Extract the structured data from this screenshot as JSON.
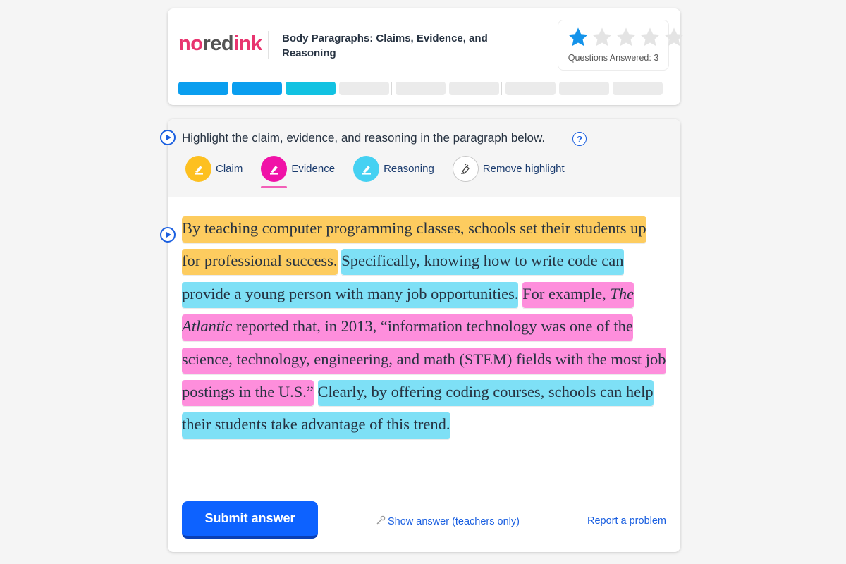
{
  "brand": {
    "logo_no": "no",
    "logo_red": "red",
    "logo_ink": "ink",
    "pink": "#e8346f"
  },
  "header": {
    "lesson_title": "Body Paragraphs: Claims, Evidence, and Reasoning",
    "stars_filled": 1,
    "stars_total": 5,
    "questions_answered_label": "Questions Answered:",
    "questions_answered_count": "3",
    "progress_segments": [
      "done",
      "done",
      "current",
      "empty",
      "gap",
      "empty",
      "empty",
      "gap",
      "empty",
      "empty",
      "empty"
    ]
  },
  "question": {
    "instruction": "Highlight the claim, evidence, and reasoning in the paragraph below.",
    "help_icon_text": "?",
    "tools": [
      {
        "label": "Claim",
        "color": "#fdc020",
        "icon": "marker-icon"
      },
      {
        "label": "Evidence",
        "color": "#f012a7",
        "icon": "marker-icon"
      },
      {
        "label": "Reasoning",
        "color": "#45d1f2",
        "icon": "marker-icon"
      },
      {
        "label": "Remove highlight",
        "color": "#ffffff",
        "icon": "eraser-icon"
      }
    ],
    "active_tool": "Evidence",
    "paragraph": {
      "claim": "By teaching computer programming classes, schools set their students up for professional success.",
      "reasoning_1": "Specifically, knowing how to write code can provide a young person with many job opportunities.",
      "evidence_pre": "For example, ",
      "evidence_italic": "The Atlantic",
      "evidence_post": " reported that, in 2013, “information technology was one of the science, technology, engineering, and math (STEM) fields with the most job postings in the U.S.”",
      "reasoning_2": "Clearly, by offering coding courses, schools can help their students take advantage of this trend."
    }
  },
  "footer": {
    "submit_label": "Submit answer",
    "show_answer_label": "Show answer (teachers only)",
    "report_label": "Report a problem"
  }
}
